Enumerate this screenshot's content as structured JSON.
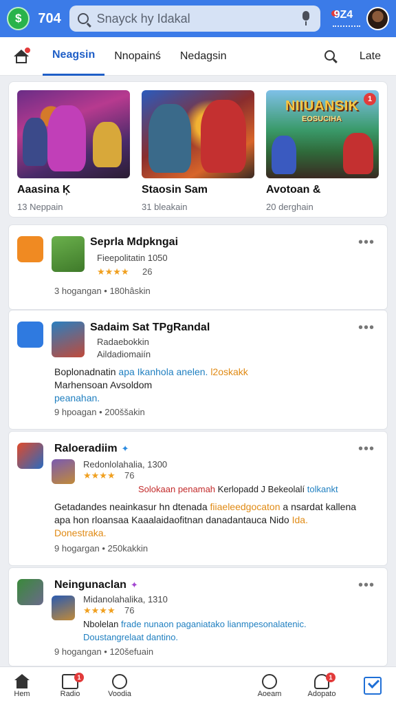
{
  "header": {
    "title": "704",
    "search_placeholder": "Snayck hy Idakal",
    "notification_count": "9Z4",
    "accent": "#3b7be8"
  },
  "tabs": {
    "items": [
      {
        "label": "Neagsin",
        "active": true
      },
      {
        "label": "Nnopainś",
        "active": false
      },
      {
        "label": "Nedagsin",
        "active": false
      }
    ],
    "late_label": "Late"
  },
  "featured": [
    {
      "title": "Aaasina Ķ",
      "meta": "13 Neppain"
    },
    {
      "title": "Staosin Sam",
      "meta": "31 bleakain"
    },
    {
      "title": "Avotoan &",
      "meta": "20 derghain",
      "art_title": "NIIUANSIK",
      "art_sub": "EOSUCIHA",
      "badge": "1"
    }
  ],
  "feed": [
    {
      "title": "Seprla Mdpkngai",
      "sub": "Fieepolitatin 1050",
      "rating": "26",
      "meta": "3 hogangan • 180hâskin"
    },
    {
      "title": "Sadaim Sat TPgRandal",
      "sub1": "Radaebokkin",
      "sub2": "Aildadiomaiín",
      "body_a": "Boplonadnatin",
      "body_b": "apa Ikanhola anelen.",
      "body_c": "l2oskakk",
      "body_d": "Marhensoan Avsoldom",
      "body_e": "peanahan.",
      "meta": "9 hpoagan • 200ššakin"
    },
    {
      "title": "Raloeradiim",
      "sub": "Redonlolahalia, 1300",
      "rating": "76",
      "highlight_red": "Solokaan penamah",
      "highlight_mid": "Kerlopadd J Bekeolalí",
      "highlight_blue": "tolkankt",
      "body_a": "Getadandes neainkasur hn dtenada",
      "body_b": "fiiaeleedgocaton",
      "body_c": "a nsardat kallena apa hon rloansaa Kaaalaidaofitnan danadantauca Nido",
      "body_d": "Ida.",
      "body_e": "Donestraka.",
      "meta": "9 hogargan • 250kakkin"
    },
    {
      "title": "Neingunaclan",
      "sub": "Midanolahalika, 1310",
      "rating": "76",
      "body_a": "Nbolelan",
      "body_b": "frade nunaon paganiatako",
      "body_c": "lianmpesonalatenic.",
      "body_d": "Doustangrelaat dantino.",
      "meta": "9 hogangan • 120šefuain"
    }
  ],
  "bottom_nav": [
    {
      "label": "Hem",
      "icon": "home-icon"
    },
    {
      "label": "Radio",
      "icon": "chat-icon",
      "badge": "1"
    },
    {
      "label": "Voodia",
      "icon": "face-icon"
    },
    {
      "label": "Aoeam",
      "icon": "heart-icon"
    },
    {
      "label": "Adopato",
      "icon": "profile-icon",
      "badge": "1"
    },
    {
      "label": "",
      "icon": "check-icon"
    }
  ],
  "more_glyph": "•••",
  "verified_glyph": "✦",
  "star_full": "★★★★",
  "star_half": "☆"
}
